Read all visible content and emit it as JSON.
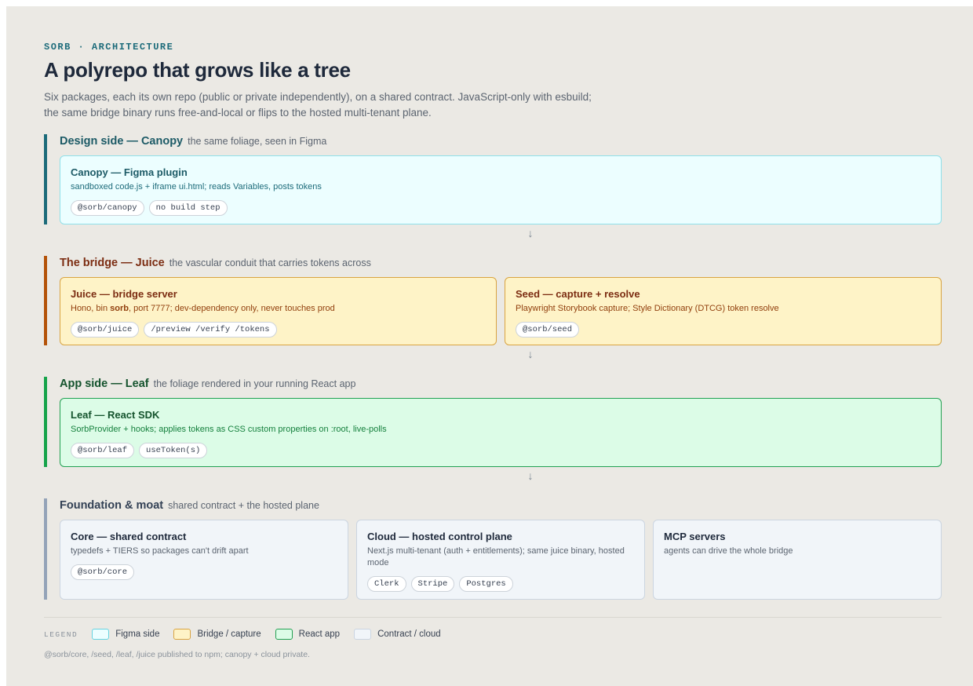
{
  "eyebrow": "SORB · ARCHITECTURE",
  "title": "A polyrepo that grows like a tree",
  "subtitle": "Six packages, each its own repo (public or private independently), on a shared contract. JavaScript-only with esbuild; the same bridge binary runs free-and-local or flips to the hosted multi-tenant plane.",
  "sections": [
    {
      "title": "Design side — Canopy",
      "subtitle": "the same foliage, seen in Figma",
      "accent": "#1c6b7a",
      "cards": [
        {
          "title": "Canopy — Figma plugin",
          "desc": "sandboxed code.js + iframe ui.html; reads Variables, posts tokens",
          "chips": [
            "@sorb/canopy",
            "no build step"
          ]
        }
      ]
    },
    {
      "title": "The bridge — Juice",
      "subtitle": "the vascular conduit that carries tokens across",
      "accent": "#b45309",
      "cards": [
        {
          "title": "Juice — bridge server",
          "desc_pre": "Hono, bin ",
          "desc_bold": "sorb",
          "desc_post": ", port 7777; dev-dependency only, never touches prod",
          "chips": [
            "@sorb/juice",
            "/preview /verify /tokens"
          ]
        },
        {
          "title": "Seed — capture + resolve",
          "desc": "Playwright Storybook capture; Style Dictionary (DTCG) token resolve",
          "chips": [
            "@sorb/seed"
          ]
        }
      ]
    },
    {
      "title": "App side — Leaf",
      "subtitle": "the foliage rendered in your running React app",
      "accent": "#16a34a",
      "cards": [
        {
          "title": "Leaf — React SDK",
          "desc": "SorbProvider + hooks; applies tokens as CSS custom properties on :root, live-polls",
          "chips": [
            "@sorb/leaf",
            "useToken(s)"
          ]
        }
      ]
    },
    {
      "title": "Foundation & moat",
      "subtitle": "shared contract + the hosted plane",
      "accent": "#94a3b8",
      "cards": [
        {
          "title": "Core — shared contract",
          "desc": "typedefs + TIERS so packages can't drift apart",
          "chips": [
            "@sorb/core"
          ]
        },
        {
          "title": "Cloud — hosted control plane",
          "desc": "Next.js multi-tenant (auth + entitlements); same juice binary, hosted mode",
          "chips": [
            "Clerk",
            "Stripe",
            "Postgres"
          ]
        },
        {
          "title": "MCP servers",
          "desc": "agents can drive the whole bridge",
          "chips": []
        }
      ]
    }
  ],
  "arrow": "↓",
  "legend": {
    "label": "LEGEND",
    "items": [
      {
        "label": "Figma side",
        "fill": "#ecfeff",
        "border": "#67d3e0"
      },
      {
        "label": "Bridge / capture",
        "fill": "#fef3c7",
        "border": "#d9a441"
      },
      {
        "label": "React app",
        "fill": "#dcfce7",
        "border": "#22a052"
      },
      {
        "label": "Contract / cloud",
        "fill": "#f1f5f9",
        "border": "#cbd5e1"
      }
    ]
  },
  "footnote": "@sorb/core, /seed, /leaf, /juice published to npm; canopy + cloud private."
}
